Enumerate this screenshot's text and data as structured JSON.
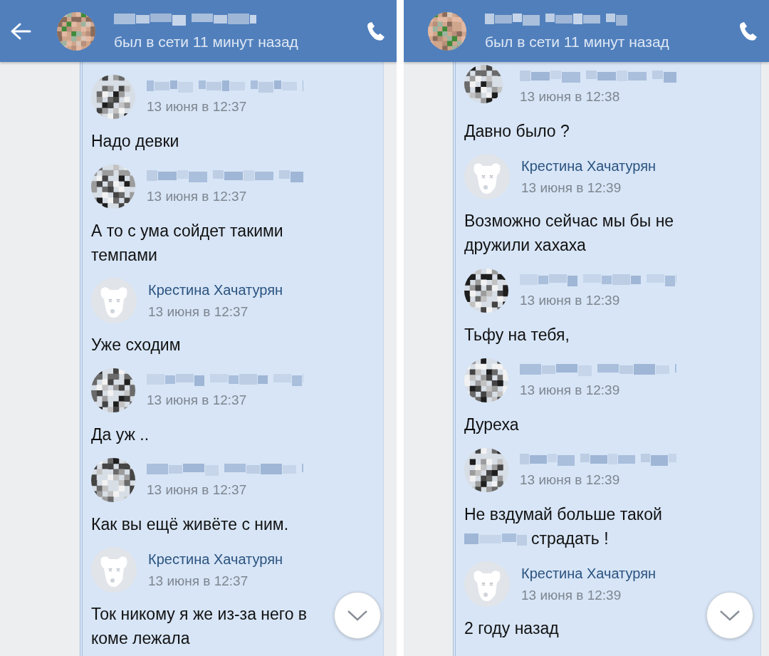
{
  "panes": [
    {
      "header": {
        "back_button": true,
        "status": "был в сети 11 минут назад"
      },
      "messages": [
        {
          "author": {
            "kind": "redacted"
          },
          "time": "13 июня в 12:37",
          "text": "Надо девки"
        },
        {
          "author": {
            "kind": "redacted"
          },
          "time": "13 июня в 12:37",
          "text": "А то с ума сойдет такими\nтемпами"
        },
        {
          "author": {
            "kind": "default",
            "name": "Крестина Хачатурян"
          },
          "time": "13 июня в 12:37",
          "text": "Уже сходим"
        },
        {
          "author": {
            "kind": "redacted"
          },
          "time": "13 июня в 12:37",
          "text": "Да уж .."
        },
        {
          "author": {
            "kind": "redacted"
          },
          "time": "13 июня в 12:37",
          "text": "Как вы ещё живёте с ним."
        },
        {
          "author": {
            "kind": "default",
            "name": "Крестина Хачатурян"
          },
          "time": "13 июня в 12:37",
          "text": "Ток никому я же из-за него в\nкоме лежала"
        }
      ],
      "scroll_button": true
    },
    {
      "header": {
        "back_button": false,
        "status": "был в сети 11 минут назад"
      },
      "messages": [
        {
          "author": {
            "kind": "redacted"
          },
          "time": "13 июня в 12:38",
          "text": "Давно было ?"
        },
        {
          "author": {
            "kind": "default",
            "name": "Крестина Хачатурян"
          },
          "time": "13 июня в 12:39",
          "text": "Возможно сейчас мы бы не\nдружили хахаха"
        },
        {
          "author": {
            "kind": "redacted"
          },
          "time": "13 июня в 12:39",
          "text": "Тьфу на тебя,"
        },
        {
          "author": {
            "kind": "redacted"
          },
          "time": "13 июня в 12:39",
          "text": "Дуреха"
        },
        {
          "author": {
            "kind": "redacted"
          },
          "time": "13 июня в 12:39",
          "text": "Не вздумай больше такой",
          "redacted_word": true,
          "text_after": "страдать !"
        },
        {
          "author": {
            "kind": "default",
            "name": "Крестина Хачатурян"
          },
          "time": "13 июня в 12:39",
          "text": "2 году назад"
        }
      ],
      "scroll_button": true
    }
  ]
}
